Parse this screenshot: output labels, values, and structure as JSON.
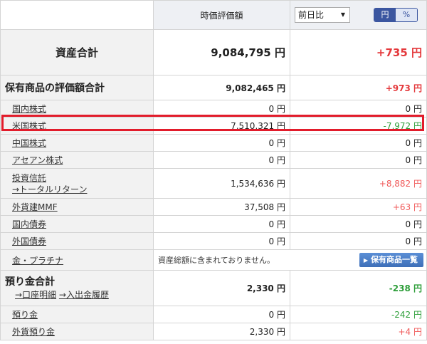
{
  "header": {
    "col_value": "時価評価額",
    "compare_select": "前日比",
    "toggle_yen": "円",
    "toggle_pct": "%"
  },
  "total": {
    "label": "資産合計",
    "value": "9,084,795 円",
    "change": "+735 円"
  },
  "holdings_total": {
    "label": "保有商品の評価額合計",
    "value": "9,082,465 円",
    "change": "+973 円"
  },
  "rows": [
    {
      "label": "国内株式",
      "value": "0 円",
      "change": "0 円"
    },
    {
      "label": "米国株式",
      "value": "7,510,321 円",
      "change": "-7,972 円"
    },
    {
      "label": "中国株式",
      "value": "0 円",
      "change": "0 円"
    },
    {
      "label": "アセアン株式",
      "value": "0 円",
      "change": "0 円"
    },
    {
      "label": "投資信託",
      "sublink": "→トータルリターン",
      "value": "1,534,636 円",
      "change": "+8,882 円"
    },
    {
      "label": "外貨建MMF",
      "value": "37,508 円",
      "change": "+63 円"
    },
    {
      "label": "国内債券",
      "value": "0 円",
      "change": "0 円"
    },
    {
      "label": "外国債券",
      "value": "0 円",
      "change": "0 円"
    },
    {
      "label": "金・プラチナ",
      "note": "資産総額に含まれておりません。",
      "button": "保有商品一覧"
    }
  ],
  "deposit_total": {
    "label": "預り金合計",
    "link1": "→口座明細",
    "link2": "→入出金履歴",
    "value": "2,330 円",
    "change": "-238 円"
  },
  "deposit_rows": [
    {
      "label": "預り金",
      "value": "0 円",
      "change": "-242 円"
    },
    {
      "label": "外貨預り金",
      "value": "2,330 円",
      "change": "+4 円"
    }
  ],
  "colors": {
    "positive": "#e4393c",
    "negative": "#2e9e3a",
    "highlight": "#e21c2b",
    "accent": "#3b56a0"
  }
}
